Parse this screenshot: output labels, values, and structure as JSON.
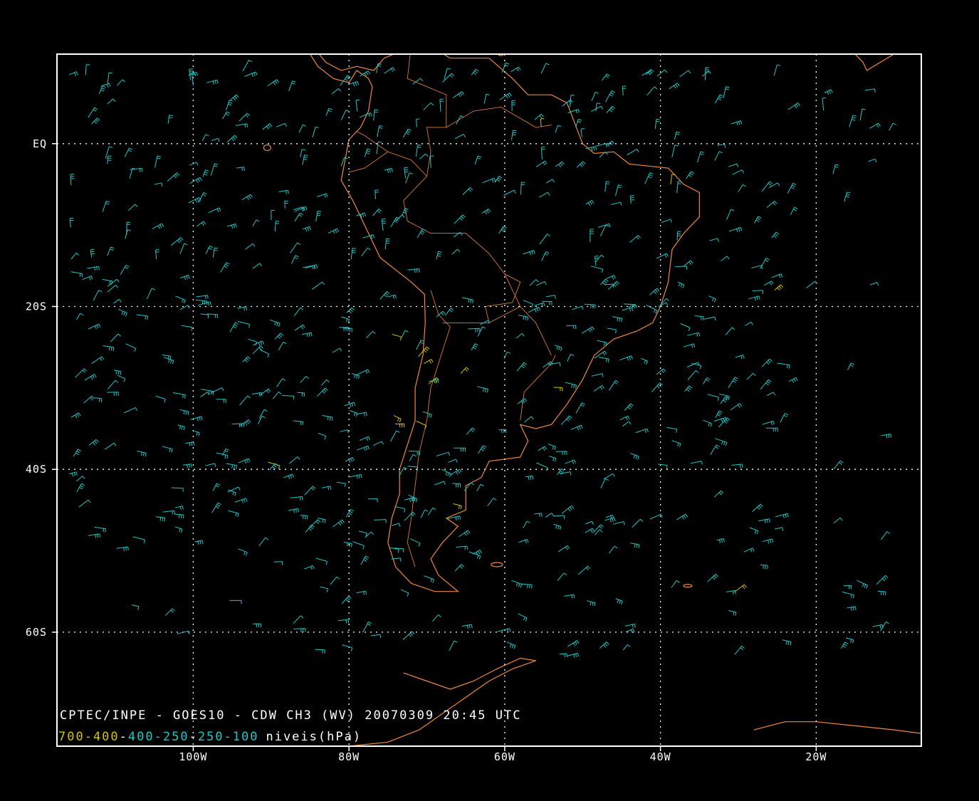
{
  "title": "CPTEC/INPE - GOES10 - CDW CH3 (WV) 20070309 20:45 UTC",
  "legend": {
    "levels": [
      {
        "label": "700-400",
        "color": "#d4c300"
      },
      {
        "label": "400-250",
        "color": "#1ec8c8"
      },
      {
        "label": "250-100",
        "color": "#1ec8c8"
      }
    ],
    "sep": "-",
    "suffix": "niveis(hPa)"
  },
  "axes": {
    "lon_range": [
      -117.5,
      -6.5
    ],
    "lat_range": [
      -74,
      11
    ],
    "x_ticks": [
      {
        "value": -100,
        "label": "100W"
      },
      {
        "value": -80,
        "label": "80W"
      },
      {
        "value": -60,
        "label": "60W"
      },
      {
        "value": -40,
        "label": "40W"
      },
      {
        "value": -20,
        "label": "20W"
      }
    ],
    "y_ticks": [
      {
        "value": 0,
        "label": "EQ"
      },
      {
        "value": -20,
        "label": "20S"
      },
      {
        "value": -40,
        "label": "40S"
      },
      {
        "value": -60,
        "label": "60S"
      }
    ],
    "grid": true
  },
  "colors": {
    "background": "#000000",
    "frame": "#ffffff",
    "coast": "#f0883c",
    "wind_upper": "#1ec8c8",
    "wind_mid": "#d4c300",
    "grid": "#ffffff"
  }
}
